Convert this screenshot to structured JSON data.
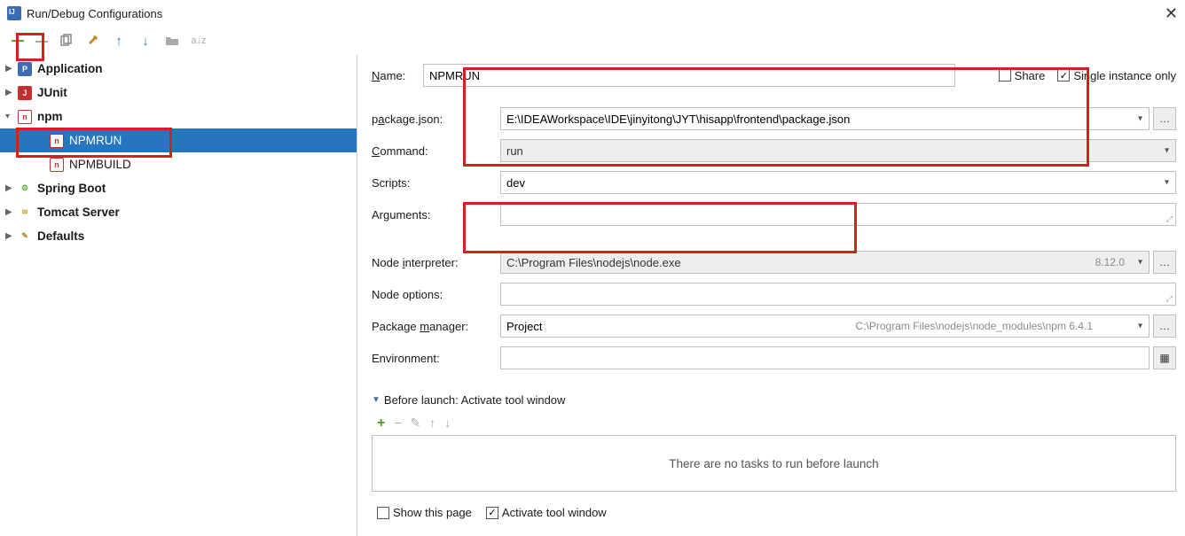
{
  "window": {
    "title": "Run/Debug Configurations"
  },
  "toolbar": {},
  "tree": {
    "application": "Application",
    "junit": "JUnit",
    "npm": "npm",
    "npmrun": "NPMRUN",
    "npmbuild": "NPMBUILD",
    "springboot": "Spring Boot",
    "tomcat": "Tomcat Server",
    "defaults": "Defaults"
  },
  "form": {
    "name_label": "Name:",
    "name_value": "NPMRUN",
    "share_label": "Share",
    "single_instance_label": "Single instance only",
    "package_label_pre": "p",
    "package_label_u": "a",
    "package_label_post": "ckage.json:",
    "package_value": "E:\\IDEAWorkspace\\IDE\\jinyitong\\JYT\\hisapp\\frontend\\package.json",
    "command_label_u": "C",
    "command_label_post": "ommand:",
    "command_value": "run",
    "scripts_label": "Scripts:",
    "scripts_value": "dev",
    "arguments_label": "Arguments:",
    "arguments_value": "",
    "node_interp_label_pre": "Node ",
    "node_interp_label_u": "i",
    "node_interp_label_post": "nterpreter:",
    "node_interp_value": "C:\\Program Files\\nodejs\\node.exe",
    "node_interp_version": "8.12.0",
    "node_options_label": "Node options:",
    "node_options_value": "",
    "pkg_mgr_label_pre": "Package ",
    "pkg_mgr_label_u": "m",
    "pkg_mgr_label_post": "anager:",
    "pkg_mgr_value": "Project",
    "pkg_mgr_hint": "C:\\Program Files\\nodejs\\node_modules\\npm   6.4.1",
    "env_label": "Environment:",
    "env_value": ""
  },
  "before_launch": {
    "header_pre": "B",
    "header_u": "e",
    "header_post": "fore launch: Activate tool window",
    "empty_text": "There are no tasks to run before launch",
    "show_page_label": "Show this page",
    "activate_label": "Activate tool window"
  }
}
